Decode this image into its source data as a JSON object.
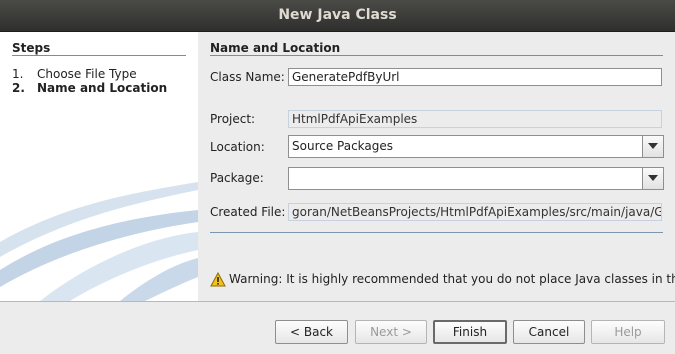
{
  "window": {
    "title": "New Java Class"
  },
  "steps": {
    "title": "Steps",
    "items": [
      {
        "num": "1.",
        "label": "Choose File Type"
      },
      {
        "num": "2.",
        "label": "Name and Location"
      }
    ]
  },
  "main": {
    "title": "Name and Location",
    "class_name": {
      "label": "Class Name:",
      "value": "GeneratePdfByUrl"
    },
    "project": {
      "label": "Project:",
      "value": "HtmlPdfApiExamples"
    },
    "location": {
      "label": "Location:",
      "value": "Source Packages"
    },
    "package": {
      "label": "Package:",
      "value": ""
    },
    "created_file": {
      "label": "Created File:",
      "value": "goran/NetBeansProjects/HtmlPdfApiExamples/src/main/java/Gene"
    },
    "warning": "Warning: It is highly recommended that you do not place Java classes in the"
  },
  "buttons": {
    "back": "< Back",
    "next": "Next >",
    "finish": "Finish",
    "cancel": "Cancel",
    "help": "Help"
  }
}
